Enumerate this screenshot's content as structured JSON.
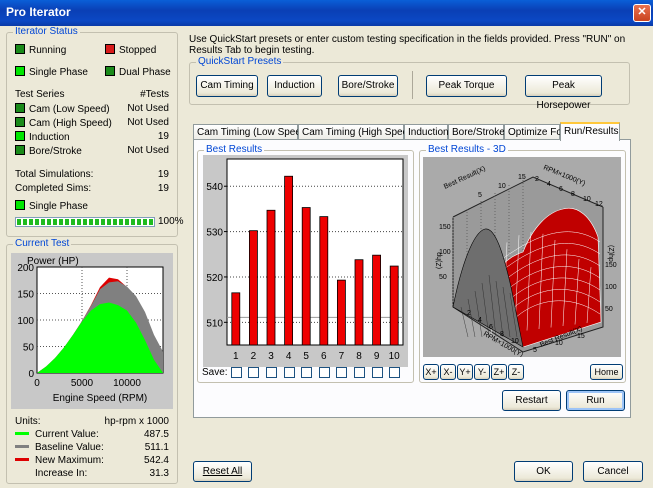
{
  "window": {
    "title": "Pro Iterator"
  },
  "colors": {
    "current": "#00ff00",
    "baseline": "#808080",
    "maximum": "#dd0000",
    "bar": "#ee0000"
  },
  "iterator_status": {
    "legend": "Iterator Status",
    "running": "Running",
    "stopped": "Stopped",
    "single_phase": "Single Phase",
    "dual_phase": "Dual Phase",
    "test_series_header": "Test Series",
    "tests_header": "#Tests",
    "series": [
      {
        "name": "Cam (Low Speed)",
        "value": "Not Used"
      },
      {
        "name": "Cam (High Speed)",
        "value": "Not Used"
      },
      {
        "name": "Induction",
        "value": "19"
      },
      {
        "name": "Bore/Stroke",
        "value": "Not Used"
      }
    ],
    "total_simulations_label": "Total Simulations:",
    "total_simulations": "19",
    "completed_sims_label": "Completed Sims:",
    "completed_sims": "19",
    "phase_label": "Single Phase",
    "progress_percent": "100%",
    "progress_fraction": 1.0
  },
  "current_test": {
    "legend": "Current Test",
    "units_label": "Units:",
    "units_value": "hp-rpm x 1000",
    "current_label": "Current Value:",
    "current_value": "487.5",
    "baseline_label": "Baseline Value:",
    "baseline_value": "511.1",
    "maximum_label": "New Maximum:",
    "maximum_value": "542.4",
    "increase_label": "Increase In:",
    "increase_value": "31.3"
  },
  "intro_text": "Use QuickStart presets or enter custom testing specification in the fields provided. Press \"RUN\" on Results Tab to begin testing.",
  "presets": {
    "legend": "QuickStart Presets",
    "cam_timing": "Cam Timing",
    "induction": "Induction",
    "bore_stroke": "Bore/Stroke",
    "peak_torque": "Peak Torque",
    "peak_horsepower": "Peak Horsepower"
  },
  "tabs": [
    "Cam Timing (Low Speed)",
    "Cam Timing (High Speed)",
    "Induction",
    "Bore/Stroke",
    "Optimize For",
    "Run/Results"
  ],
  "best_results": {
    "legend": "Best Results",
    "save_label": "Save:"
  },
  "best_results_3d": {
    "legend": "Best Results - 3D",
    "nav": [
      "X+",
      "X-",
      "Y+",
      "Y-",
      "Z+",
      "Z-"
    ],
    "home": "Home",
    "axis_label_best": "Best Result(X)",
    "axis_label_rpm": "RPM×1000(Y)",
    "axis_label_z": "(Z)hp",
    "ticks_z": [
      "150",
      "100",
      "50"
    ],
    "ticks_best_top": [
      "5",
      "10",
      "15"
    ],
    "ticks_rpm_top": [
      "2",
      "4",
      "6",
      "8",
      "10",
      "12"
    ],
    "ticks_best_bottom": [
      "5",
      "10",
      "15"
    ],
    "ticks_rpm_bottom": [
      "2",
      "4",
      "6",
      "8",
      "10"
    ]
  },
  "buttons": {
    "restart": "Restart",
    "run": "Run",
    "reset_all": "Reset All",
    "ok": "OK",
    "cancel": "Cancel"
  },
  "chart_data": [
    {
      "type": "bar",
      "title": "Best Results",
      "categories": [
        "1",
        "2",
        "3",
        "4",
        "5",
        "6",
        "7",
        "8",
        "9",
        "10"
      ],
      "values": [
        516.5,
        530.2,
        534.7,
        542.2,
        535.3,
        533.3,
        519.3,
        523.8,
        524.8,
        522.4
      ],
      "ylim": [
        505,
        546
      ],
      "yticks": [
        "510",
        "520",
        "530",
        "540"
      ],
      "grid": true
    },
    {
      "type": "area",
      "title": "Power (HP)",
      "xlabel": "Engine Speed (RPM)",
      "xlim": [
        0,
        14000
      ],
      "ylim": [
        0,
        200
      ],
      "xticks": [
        "0",
        "5000",
        "10000"
      ],
      "yticks": [
        "0",
        "50",
        "100",
        "150",
        "200"
      ],
      "x": [
        0,
        1000,
        2000,
        3000,
        4000,
        5000,
        6000,
        7000,
        8000,
        9000,
        10000,
        11000,
        12000,
        13000,
        14000
      ],
      "series": [
        {
          "color": "#dd0000",
          "values": [
            0,
            12,
            28,
            48,
            72,
            98,
            128,
            162,
            180,
            177,
            162,
            142,
            110,
            68,
            35
          ]
        },
        {
          "color": "#808080",
          "values": [
            0,
            12,
            28,
            48,
            72,
            98,
            127,
            158,
            171,
            173,
            163,
            145,
            115,
            72,
            40
          ]
        },
        {
          "color": "#00ff00",
          "values": [
            0,
            12,
            28,
            48,
            72,
            97,
            118,
            130,
            133,
            128,
            118,
            95,
            62,
            25,
            0
          ]
        }
      ]
    }
  ]
}
